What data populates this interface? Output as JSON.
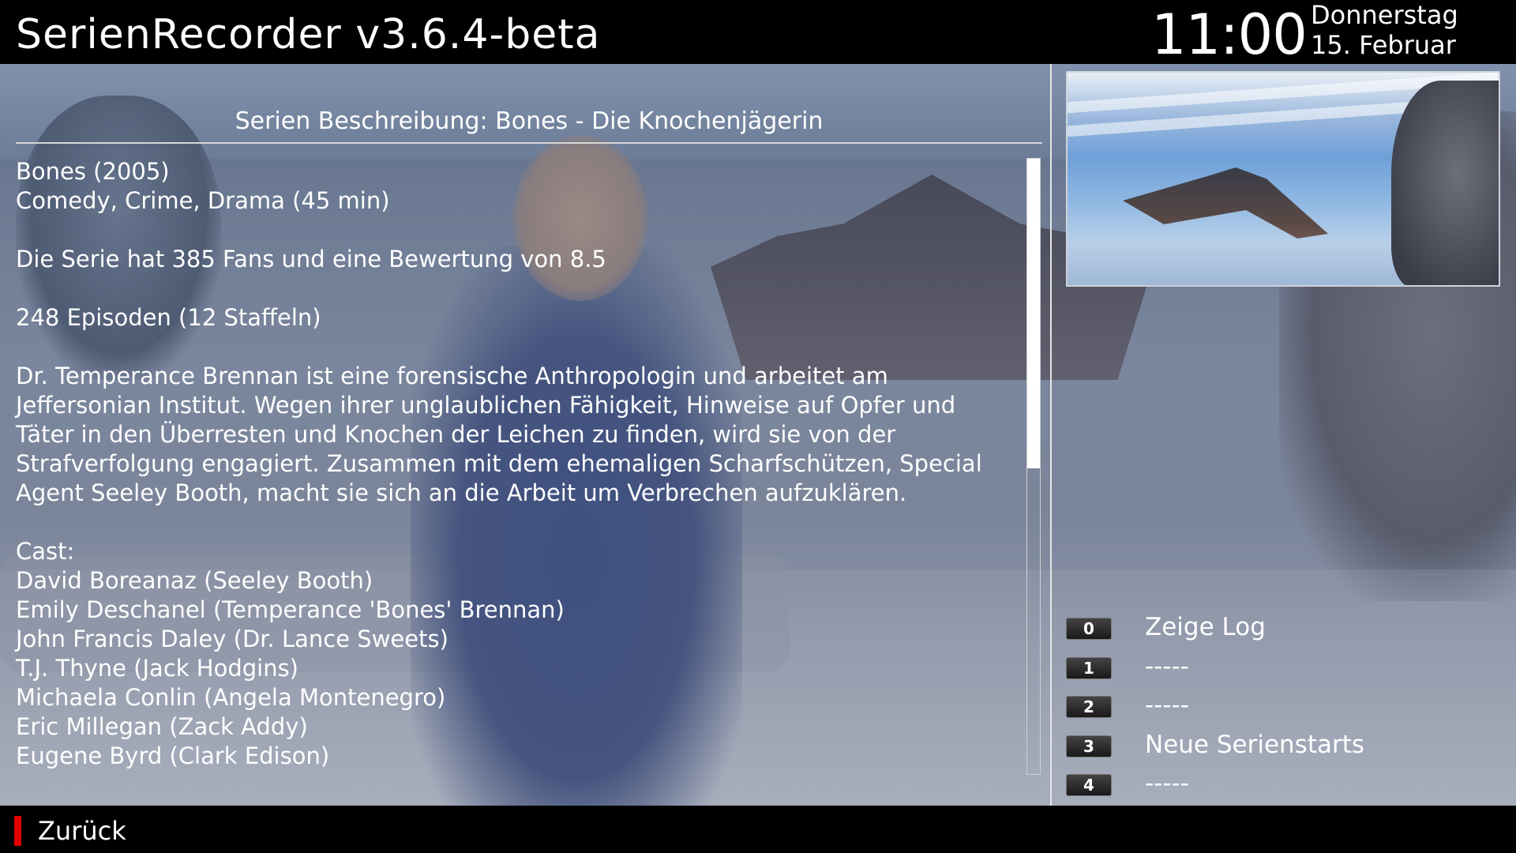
{
  "header": {
    "app_title": "SerienRecorder v3.6.4-beta",
    "time": "11:00",
    "weekday": "Donnerstag",
    "date": "15. Februar"
  },
  "description": {
    "heading": "Serien Beschreibung: Bones - Die Knochenjägerin",
    "lines": [
      "Bones (2005)",
      "Comedy, Crime, Drama (45 min)",
      "",
      "Die Serie hat 385 Fans und eine Bewertung von 8.5",
      "",
      "248 Episoden (12 Staffeln)",
      "",
      "Dr. Temperance Brennan ist eine forensische Anthropologin und arbeitet am",
      "Jeffersonian Institut. Wegen ihrer unglaublichen Fähigkeit, Hinweise auf Opfer und",
      "Täter in den Überresten und Knochen der Leichen zu finden, wird sie von der",
      "Strafverfolgung engagiert. Zusammen mit dem ehemaligen Scharfschützen, Special",
      "Agent Seeley Booth, macht sie sich an die Arbeit um Verbrechen aufzuklären.",
      "",
      "Cast:",
      "David Boreanaz (Seeley Booth)",
      "Emily Deschanel (Temperance 'Bones' Brennan)",
      "John Francis Daley (Dr. Lance Sweets)",
      "T.J. Thyne (Jack Hodgins)",
      "Michaela Conlin (Angela Montenegro)",
      "Eric Millegan (Zack Addy)",
      "Eugene Byrd (Clark Edison)"
    ],
    "scroll_position_fraction": 0.5
  },
  "menu": {
    "items": [
      {
        "key": "0",
        "label": "Zeige Log"
      },
      {
        "key": "1",
        "label": "-----"
      },
      {
        "key": "2",
        "label": "-----"
      },
      {
        "key": "3",
        "label": "Neue Serienstarts"
      },
      {
        "key": "4",
        "label": "-----"
      }
    ]
  },
  "footer": {
    "back_label": "Zurück",
    "back_key_color": "#e10000"
  }
}
